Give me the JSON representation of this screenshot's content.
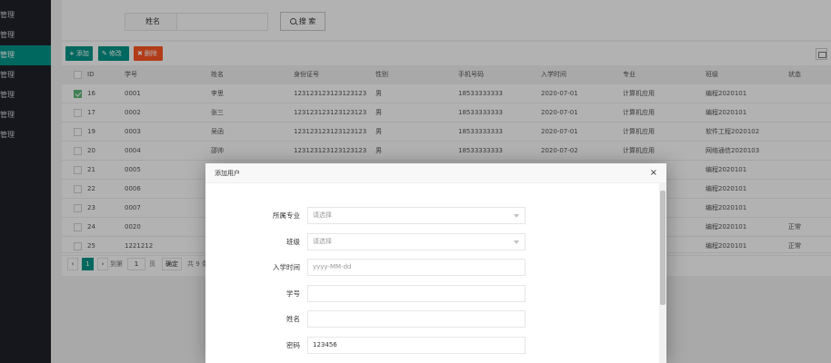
{
  "sidebar": {
    "items": [
      {
        "label": "管理",
        "active": false
      },
      {
        "label": "管理",
        "active": false
      },
      {
        "label": "管理",
        "active": true
      },
      {
        "label": "管理",
        "active": false
      },
      {
        "label": "管理",
        "active": false
      },
      {
        "label": "管理",
        "active": false
      },
      {
        "label": "管理",
        "active": false
      }
    ]
  },
  "search": {
    "label": "姓名",
    "value": "",
    "button_label": "搜 索"
  },
  "toolbar": {
    "add_label": "添加",
    "edit_label": "修改",
    "delete_label": "删除"
  },
  "table": {
    "columns": [
      "ID",
      "学号",
      "姓名",
      "身份证号",
      "性别",
      "手机号码",
      "入学时间",
      "专业",
      "班级",
      "状态"
    ],
    "rows": [
      {
        "checked": true,
        "id": "16",
        "sno": "0001",
        "name": "李思",
        "idcard": "123123123123123123",
        "sex": "男",
        "phone": "18533333333",
        "date": "2020-07-01",
        "major": "计算机应用",
        "class": "编程2020101",
        "status": ""
      },
      {
        "checked": false,
        "id": "17",
        "sno": "0002",
        "name": "张三",
        "idcard": "123123123123123123",
        "sex": "男",
        "phone": "18533333333",
        "date": "2020-07-01",
        "major": "计算机应用",
        "class": "编程2020101",
        "status": ""
      },
      {
        "checked": false,
        "id": "19",
        "sno": "0003",
        "name": "吴函",
        "idcard": "123123123123123123",
        "sex": "男",
        "phone": "18533333333",
        "date": "2020-07-01",
        "major": "计算机应用",
        "class": "软件工程2020102",
        "status": ""
      },
      {
        "checked": false,
        "id": "20",
        "sno": "0004",
        "name": "邵帅",
        "idcard": "123123123123123123",
        "sex": "男",
        "phone": "18533333333",
        "date": "2020-07-02",
        "major": "计算机应用",
        "class": "网络通信2020103",
        "status": ""
      },
      {
        "checked": false,
        "id": "21",
        "sno": "0005",
        "name": "",
        "idcard": "",
        "sex": "",
        "phone": "",
        "date": "",
        "major": "",
        "class": "编程2020101",
        "status": ""
      },
      {
        "checked": false,
        "id": "22",
        "sno": "0006",
        "name": "",
        "idcard": "",
        "sex": "",
        "phone": "",
        "date": "",
        "major": "",
        "class": "编程2020101",
        "status": ""
      },
      {
        "checked": false,
        "id": "23",
        "sno": "0007",
        "name": "",
        "idcard": "",
        "sex": "",
        "phone": "",
        "date": "",
        "major": "",
        "class": "编程2020101",
        "status": ""
      },
      {
        "checked": false,
        "id": "24",
        "sno": "0020",
        "name": "",
        "idcard": "",
        "sex": "",
        "phone": "",
        "date": "",
        "major": "",
        "class": "编程2020101",
        "status": "正常"
      },
      {
        "checked": false,
        "id": "25",
        "sno": "1221212",
        "name": "",
        "idcard": "",
        "sex": "",
        "phone": "",
        "date": "",
        "major": "",
        "class": "编程2020101",
        "status": "正常"
      }
    ]
  },
  "pager": {
    "prev": "‹",
    "current": "1",
    "next": "›",
    "goto_label": "到第",
    "goto_value": "1",
    "page_unit": "页",
    "confirm_label": "确定",
    "total_text": "共 9 条"
  },
  "modal": {
    "title": "添加用户",
    "close": "×",
    "fields": [
      {
        "label": "所属专业",
        "value": "请选择",
        "type": "select",
        "filled": false
      },
      {
        "label": "班级",
        "value": "请选择",
        "type": "select",
        "filled": false
      },
      {
        "label": "入学时间",
        "value": "yyyy-MM-dd",
        "type": "date",
        "filled": false
      },
      {
        "label": "学号",
        "value": "",
        "type": "text",
        "filled": false
      },
      {
        "label": "姓名",
        "value": "",
        "type": "text",
        "filled": false
      },
      {
        "label": "密码",
        "value": "123456",
        "type": "text",
        "filled": true
      }
    ]
  }
}
